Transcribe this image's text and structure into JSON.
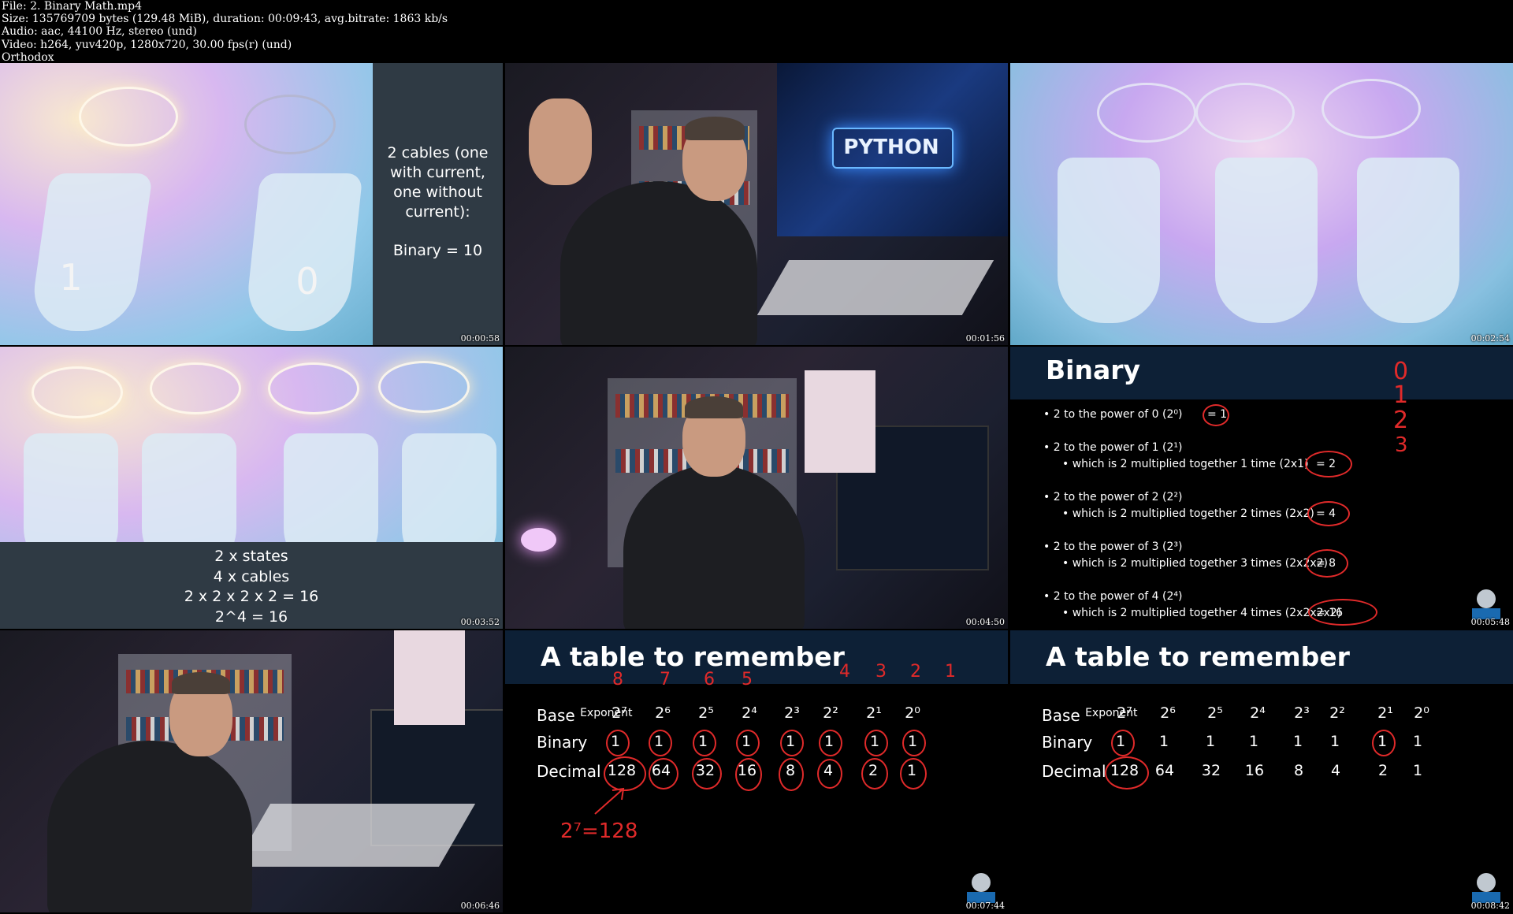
{
  "file_info": {
    "file": "File: 2. Binary Math.mp4",
    "size": "Size: 135769709 bytes (129.48 MiB), duration: 00:09:43, avg.bitrate: 1863 kb/s",
    "audio": "Audio: aac, 44100 Hz, stereo (und)",
    "video": "Video: h264, yuv420p, 1280x720, 30.00 fps(r) (und)",
    "tag": "Orthodox"
  },
  "tiles": [
    {
      "timestamp": "00:00:58",
      "label_one": "1",
      "label_zero": "0",
      "panel_lines": [
        "2 cables (one",
        "with current,",
        "one without",
        "current):"
      ],
      "panel_result": "Binary = 10"
    },
    {
      "timestamp": "00:01:56",
      "screen_text": "PYTHON"
    },
    {
      "timestamp": "00:02:54"
    },
    {
      "timestamp": "00:03:52",
      "lines": [
        "2 x states",
        "4 x cables",
        "2 x 2 x 2 x 2 = 16",
        "2^4 = 16"
      ]
    },
    {
      "timestamp": "00:04:50"
    },
    {
      "timestamp": "00:05:48",
      "title": "Binary",
      "bullets": [
        {
          "main": "2 to the power of 0 (2⁰)",
          "result": "= 1"
        },
        {
          "main": "2 to the power of 1 (2¹)",
          "sub": "which is 2 multiplied together 1 time (2x1)",
          "result": "= 2"
        },
        {
          "main": "2 to the power of 2 (2²)",
          "sub": "which is 2 multiplied together 2 times (2x2)",
          "result": "= 4"
        },
        {
          "main": "2 to the power of 3 (2³)",
          "sub": "which is 2 multiplied together 3 times (2x2x2)",
          "result": "= 8"
        },
        {
          "main": "2 to the power of 4 (2⁴)",
          "sub": "which is 2 multiplied together 4 times (2x2x2x2)",
          "result": "= 16"
        }
      ],
      "annotations": [
        "0",
        "1",
        "2",
        "3"
      ]
    },
    {
      "timestamp": "00:06:46"
    },
    {
      "timestamp": "00:07:44",
      "title": "A table to remember",
      "row_labels": [
        "Base",
        "Exponent",
        "Binary",
        "Decimal"
      ],
      "powers": [
        "2⁷",
        "2⁶",
        "2⁵",
        "2⁴",
        "2³",
        "2²",
        "2¹",
        "2⁰"
      ],
      "binary": [
        "1",
        "1",
        "1",
        "1",
        "1",
        "1",
        "1",
        "1"
      ],
      "decimal": [
        "128",
        "64",
        "32",
        "16",
        "8",
        "4",
        "2",
        "1"
      ],
      "annotations_top": [
        "8",
        "7",
        "6",
        "5",
        "4",
        "3",
        "2",
        "1"
      ],
      "note": "2⁷=128"
    },
    {
      "timestamp": "00:08:42",
      "title": "A table to remember",
      "row_labels": [
        "Base",
        "Exponent",
        "Binary",
        "Decimal"
      ],
      "powers": [
        "2⁷",
        "2⁶",
        "2⁵",
        "2⁴",
        "2³",
        "2²",
        "2¹",
        "2⁰"
      ],
      "binary": [
        "1",
        "1",
        "1",
        "1",
        "1",
        "1",
        "1",
        "1"
      ],
      "decimal": [
        "128",
        "64",
        "32",
        "16",
        "8",
        "4",
        "2",
        "1"
      ]
    }
  ],
  "colors": {
    "annotation_red": "#e02a2a",
    "slide_header": "#0d2036",
    "panel": "#2f3a44"
  },
  "icons": [
    "david-bombal-logo-icon"
  ]
}
